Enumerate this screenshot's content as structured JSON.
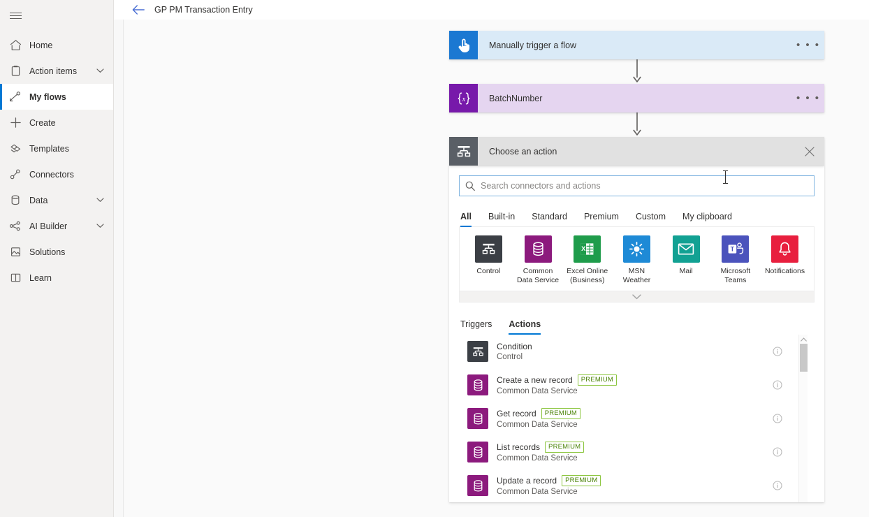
{
  "sidebar": {
    "menu_icon": "hamburger-icon",
    "items": [
      {
        "label": "Home",
        "icon": "home-icon",
        "expandable": false,
        "active": false
      },
      {
        "label": "Action items",
        "icon": "clipboard-icon",
        "expandable": true,
        "active": false
      },
      {
        "label": "My flows",
        "icon": "flow-icon",
        "expandable": false,
        "active": true
      },
      {
        "label": "Create",
        "icon": "plus-icon",
        "expandable": false,
        "active": false
      },
      {
        "label": "Templates",
        "icon": "templates-icon",
        "expandable": false,
        "active": false
      },
      {
        "label": "Connectors",
        "icon": "connectors-icon",
        "expandable": false,
        "active": false
      },
      {
        "label": "Data",
        "icon": "database-icon",
        "expandable": true,
        "active": false
      },
      {
        "label": "AI Builder",
        "icon": "ai-nodes-icon",
        "expandable": true,
        "active": false
      },
      {
        "label": "Solutions",
        "icon": "solutions-icon",
        "expandable": false,
        "active": false
      },
      {
        "label": "Learn",
        "icon": "book-icon",
        "expandable": false,
        "active": false
      }
    ]
  },
  "topbar": {
    "back_icon": "back-arrow-icon",
    "title": "GP PM Transaction Entry"
  },
  "flow": {
    "cards": [
      {
        "title": "Manually trigger a flow",
        "icon": "manual-trigger-hand-icon",
        "icon_bg": "#1b78d2",
        "body_bg": "#daeaf7",
        "menu": "• • •"
      },
      {
        "title": "BatchNumber",
        "icon": "variable-braces-icon",
        "icon_bg": "#7719aa",
        "body_bg": "#e5d5f0",
        "menu": "• • •"
      }
    ],
    "chooser_header": {
      "title": "Choose an action",
      "icon": "control-branch-icon",
      "icon_bg": "#5a5f66",
      "body_bg": "#e1e1e1",
      "close_icon": "close-icon"
    }
  },
  "picker": {
    "search": {
      "placeholder": "Search connectors and actions",
      "value": "",
      "icon": "search-icon"
    },
    "filter_tabs": [
      {
        "label": "All",
        "active": true
      },
      {
        "label": "Built-in",
        "active": false
      },
      {
        "label": "Standard",
        "active": false
      },
      {
        "label": "Premium",
        "active": false
      },
      {
        "label": "Custom",
        "active": false
      },
      {
        "label": "My clipboard",
        "active": false
      }
    ],
    "connectors": [
      {
        "name": "Control",
        "icon": "control-branch-icon",
        "color": "#3b3f45"
      },
      {
        "name": "Common\nData Service",
        "icon": "database-icon",
        "color": "#8c1a7d"
      },
      {
        "name": "Excel Online\n(Business)",
        "icon": "excel-icon",
        "color": "#1f9c4b"
      },
      {
        "name": "MSN\nWeather",
        "icon": "sun-icon",
        "color": "#1e8ad6"
      },
      {
        "name": "Mail",
        "icon": "envelope-icon",
        "color": "#12a193"
      },
      {
        "name": "Microsoft\nTeams",
        "icon": "teams-icon",
        "color": "#4b53bc"
      },
      {
        "name": "Notifications",
        "icon": "bell-icon",
        "color": "#e81f3e"
      }
    ],
    "expand_icon": "chevron-down-icon",
    "result_tabs": [
      {
        "label": "Triggers",
        "active": false
      },
      {
        "label": "Actions",
        "active": true
      }
    ],
    "actions": [
      {
        "title": "Condition",
        "badge": "",
        "subtitle": "Control",
        "icon": "control-branch-icon",
        "color": "#3b3f45",
        "info": "info-icon"
      },
      {
        "title": "Create a new record",
        "badge": "PREMIUM",
        "subtitle": "Common Data Service",
        "icon": "database-icon",
        "color": "#8c1a7d",
        "info": "info-icon"
      },
      {
        "title": "Get record",
        "badge": "PREMIUM",
        "subtitle": "Common Data Service",
        "icon": "database-icon",
        "color": "#8c1a7d",
        "info": "info-icon"
      },
      {
        "title": "List records",
        "badge": "PREMIUM",
        "subtitle": "Common Data Service",
        "icon": "database-icon",
        "color": "#8c1a7d",
        "info": "info-icon"
      },
      {
        "title": "Update a record",
        "badge": "PREMIUM",
        "subtitle": "Common Data Service",
        "icon": "database-icon",
        "color": "#8c1a7d",
        "info": "info-icon"
      }
    ],
    "scrollbar": {
      "up_icon": "scroll-up-arrow-icon"
    }
  }
}
